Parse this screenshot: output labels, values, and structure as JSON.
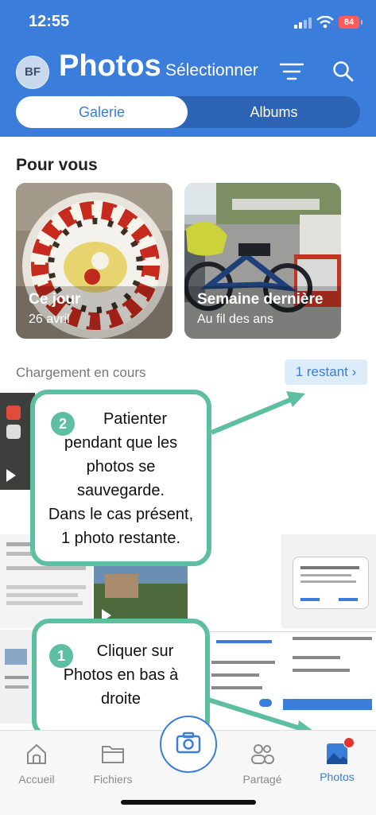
{
  "status": {
    "time": "12:55",
    "battery": "84"
  },
  "header": {
    "avatar_initials": "BF",
    "title": "Photos",
    "select_label": "Sélectionner",
    "tabs": [
      {
        "label": "Galerie",
        "active": true
      },
      {
        "label": "Albums",
        "active": false
      }
    ]
  },
  "for_you": {
    "title": "Pour vous",
    "cards": [
      {
        "title": "Ce jour",
        "subtitle": "26 avril"
      },
      {
        "title": "Semaine dernière",
        "subtitle": "Au fil des ans"
      }
    ]
  },
  "uploading": {
    "label": "Chargement en cours",
    "remaining": "1 restant ›"
  },
  "callouts": [
    {
      "number": "2",
      "lines": [
        "Patienter",
        "pendant que les",
        "photos se",
        "sauvegarde.",
        "Dans le cas présent,",
        "1 photo restante."
      ]
    },
    {
      "number": "1",
      "lines": [
        "Cliquer sur",
        "Photos en bas à",
        "droite"
      ]
    }
  ],
  "tabbar": {
    "items": [
      {
        "label": "Accueil",
        "icon": "home-icon"
      },
      {
        "label": "Fichiers",
        "icon": "folder-icon"
      },
      {
        "label": "Partagé",
        "icon": "people-icon"
      },
      {
        "label": "Photos",
        "icon": "photos-icon",
        "active": true
      }
    ]
  },
  "colors": {
    "brand": "#3a7ddb",
    "callout": "#5dbf9f"
  }
}
